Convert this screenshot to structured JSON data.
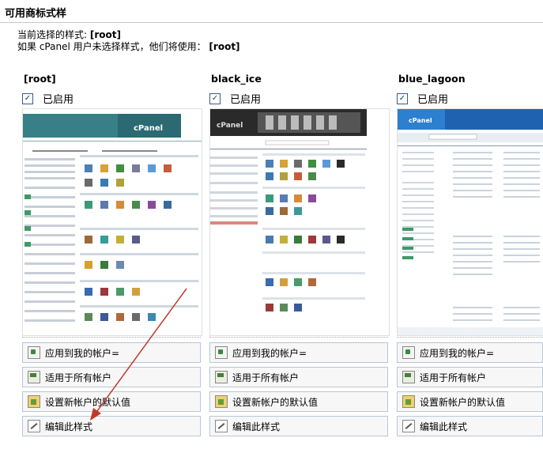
{
  "page": {
    "title": "可用商标式样",
    "current_line_prefix": "当前选择的样式: ",
    "current_value": "[root]",
    "fallback_line_prefix": "如果 cPanel 用户未选择样式，他们将使用： ",
    "fallback_value": "[root]"
  },
  "themes": [
    {
      "name": "[root]",
      "enabled_label": "已启用",
      "enabled": true,
      "thumb_banner_text": "cPanel",
      "actions": [
        {
          "label": "应用到我的帐户=",
          "icon": "apply-icon"
        },
        {
          "label": "适用于所有帐户",
          "icon": "all-accounts-icon"
        },
        {
          "label": "设置新帐户的默认值",
          "icon": "default-icon"
        },
        {
          "label": "编辑此样式",
          "icon": "edit-icon"
        }
      ]
    },
    {
      "name": "black_ice",
      "enabled_label": "已启用",
      "enabled": true,
      "thumb_banner_text": "cPanel",
      "actions": [
        {
          "label": "应用到我的帐户=",
          "icon": "apply-icon"
        },
        {
          "label": "适用于所有帐户",
          "icon": "all-accounts-icon"
        },
        {
          "label": "设置新帐户的默认值",
          "icon": "default-icon"
        },
        {
          "label": "编辑此样式",
          "icon": "edit-icon"
        }
      ]
    },
    {
      "name": "blue_lagoon",
      "enabled_label": "已启用",
      "enabled": true,
      "thumb_banner_text": "cPanel",
      "actions": [
        {
          "label": "应用到我的帐户=",
          "icon": "apply-icon"
        },
        {
          "label": "适用于所有帐户",
          "icon": "all-accounts-icon"
        },
        {
          "label": "设置新帐户的默认值",
          "icon": "default-icon"
        },
        {
          "label": "编辑此样式",
          "icon": "edit-icon"
        }
      ]
    }
  ],
  "colors": {
    "annotation_arrow": "#c0392b",
    "root_banner": "#2b6a73",
    "black_ice_banner": "#2a2a2a",
    "blue_lagoon_banner": "#1f63b0"
  }
}
